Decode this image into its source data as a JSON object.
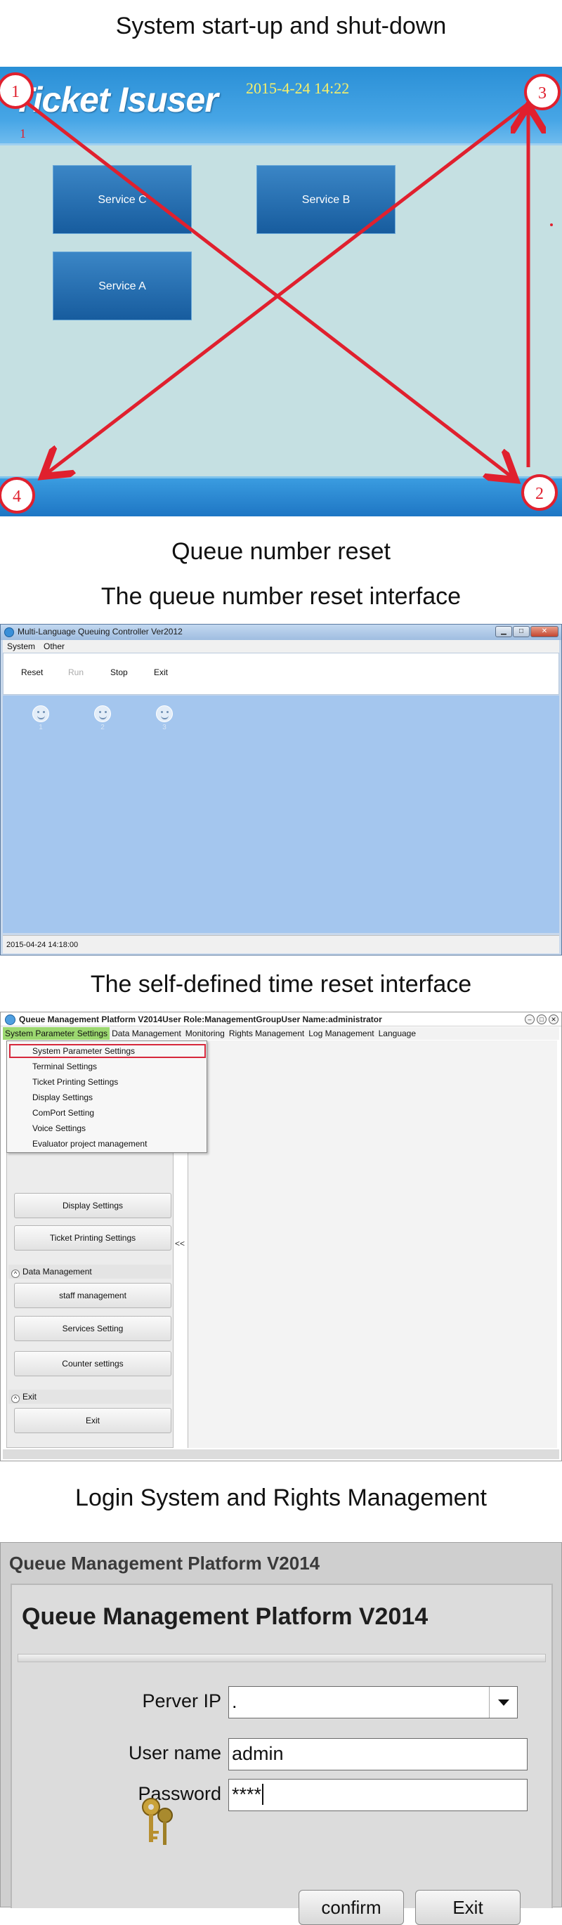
{
  "section1": {
    "heading": "System start-up and shut-down",
    "app_title": "Ticket Isuser",
    "datetime": "2015-4-24   14:22",
    "services": [
      "Service C",
      "Service B",
      "Service A"
    ],
    "markers": [
      "1",
      "3",
      "4",
      "2"
    ],
    "marker_small": "1",
    "annotation_color": "#e0202e"
  },
  "section2": {
    "heading": "Queue number reset",
    "subheading": "The queue number reset interface",
    "window_title": "Multi-Language Queuing Controller Ver2012",
    "menu": [
      "System",
      "Other"
    ],
    "tools": [
      {
        "label": "Reset",
        "enabled": true
      },
      {
        "label": "Run",
        "enabled": false
      },
      {
        "label": "Stop",
        "enabled": true
      },
      {
        "label": "Exit",
        "enabled": true
      }
    ],
    "counters": [
      "1",
      "2",
      "3"
    ],
    "status_time": "2015-04-24 14:18:00"
  },
  "section3": {
    "heading": "The self-defined time reset interface",
    "window_title": "Queue Management Platform V2014User Role:ManagementGroupUser Name:administrator",
    "menu": [
      "System Parameter Settings",
      "Data Management",
      "Monitoring",
      "Rights Management",
      "Log Management",
      "Language"
    ],
    "dropdown": [
      "System Parameter Settings",
      "Terminal Settings",
      "Ticket Printing Settings",
      "Display Settings",
      "ComPort Setting",
      "Voice Settings",
      "Evaluator project management"
    ],
    "nav_buttons_top": [
      "Display Settings",
      "Ticket Printing Settings"
    ],
    "section_data": "Data Management",
    "nav_buttons_data": [
      "staff management",
      "Services Setting",
      "Counter settings"
    ],
    "section_exit": "Exit",
    "exit_button": "Exit",
    "collapse": "<<"
  },
  "section4": {
    "heading": "Login System and Rights Management",
    "window_title": "Queue Management Platform V2014",
    "form_title": "Queue Management Platform V2014",
    "server_ip_label": "Perver IP",
    "server_ip_value": ".",
    "username_label": "User name",
    "username_value": "admin",
    "password_label": "Password",
    "password_value": "****",
    "confirm": "confirm",
    "exit": "Exit"
  }
}
